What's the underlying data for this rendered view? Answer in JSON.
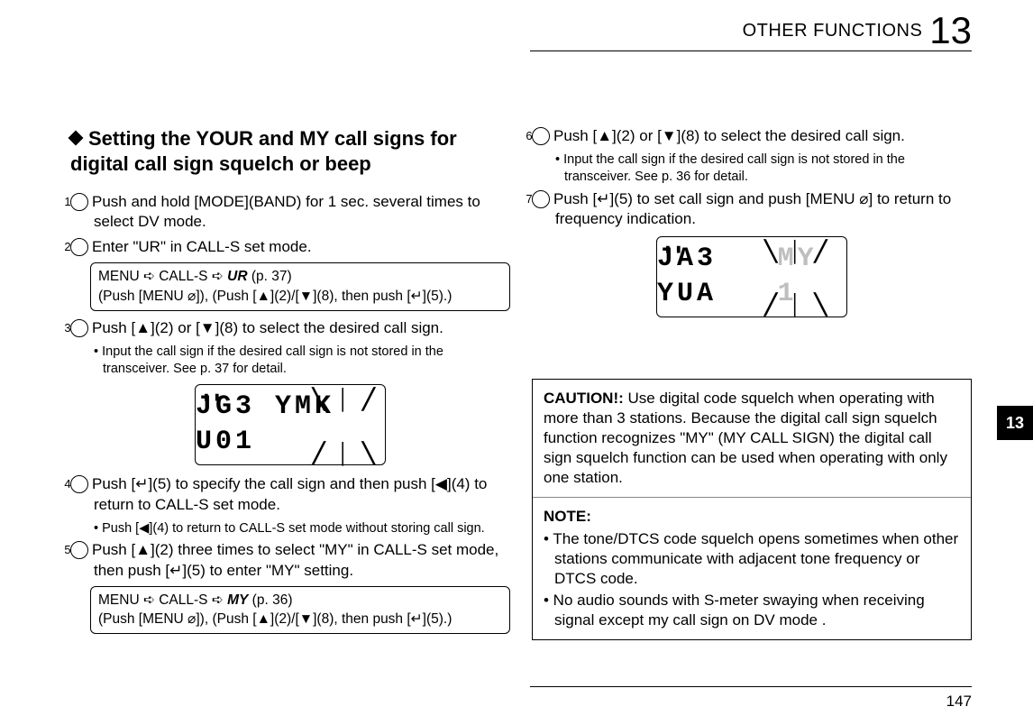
{
  "header": {
    "title": "OTHER FUNCTIONS",
    "chapter": "13"
  },
  "section": {
    "title_line1": "Setting the YOUR and MY call signs for",
    "title_line2": "digital call sign squelch or beep"
  },
  "left": {
    "s1": "Push and hold [MODE](BAND) for 1 sec. several times to select DV mode.",
    "s2": "Enter \"UR\" in CALL-S set mode.",
    "menu1_a": "MENU ➪ CALL-S ➪ ",
    "menu1_b": "UR",
    "menu1_c": " (p. 37)",
    "menu1_d": "(Push [MENU ⌀]), (Push [▲](2)/[▼](8), then push [↵](5).)",
    "s3": "Push [▲](2) or [▼](8) to select the desired call sign.",
    "s3_sub": "• Input the call sign if the desired call sign is not stored in the transceiver. See p. 37 for detail.",
    "lcd1": "JG3 YMK U01",
    "s4": "Push [↵](5) to specify the call sign and then push [◀](4) to return to CALL-S set mode.",
    "s4_sub": "• Push [◀](4) to return to CALL-S set mode without storing call sign.",
    "s5": "Push [▲](2) three times to select \"MY\" in CALL-S set mode, then push [↵](5) to enter \"MY\" setting.",
    "menu2_a": "MENU ➪ CALL-S ➪ ",
    "menu2_b": "MY",
    "menu2_c": " (p. 36)",
    "menu2_d": "(Push [MENU ⌀]), (Push [▲](2)/[▼](8), then push [↵](5).)"
  },
  "right": {
    "s6": "Push [▲](2) or [▼](8) to select the desired call sign.",
    "s6_sub": "• Input the call sign if the desired call sign is not stored in the transceiver. See p. 36 for detail.",
    "s7": "Push [↵](5) to set call sign and push [MENU ⌀] to return to frequency indication.",
    "lcd2_a": "JA3 YUA ",
    "lcd2_b": "MY 1",
    "caution_title": "CAUTION!:",
    "caution_body": " Use digital code squelch when operating with more than 3 stations. Because the digital call sign squelch function recognizes \"MY\" (MY CALL SIGN) the digital call sign squelch function can be used when operating with only one station.",
    "note_title": "NOTE:",
    "note1": "• The tone/DTCS code squelch opens sometimes when other stations communicate with adjacent tone frequency or DTCS code.",
    "note2": "• No audio sounds with S-meter swaying when receiving signal except my call sign on DV mode ."
  },
  "page_number": "147",
  "tab_label": "13",
  "nums": {
    "n1": "1",
    "n2": "2",
    "n3": "3",
    "n4": "4",
    "n5": "5",
    "n6": "6",
    "n7": "7"
  }
}
